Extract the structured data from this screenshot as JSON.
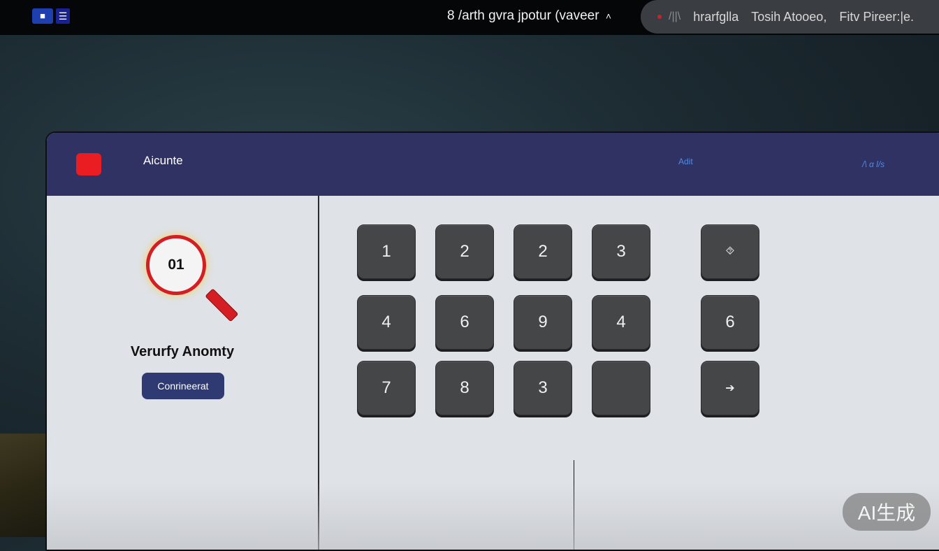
{
  "topbar": {
    "icon_a": "■",
    "icon_b": "☰",
    "title": "8 /arth gvra jpotur (vaveer",
    "title_caret": "˄",
    "pill": {
      "slash": "/||\\",
      "items": [
        "hrarfglla",
        "Tosih Atooeo,",
        "Fitv Pireer:|e."
      ]
    }
  },
  "window": {
    "app_name": "Aicunte",
    "header_link": "Adit",
    "header_icon_text": "/\\ α l/s",
    "verify": {
      "badge_number": "01",
      "title": "Verurfy Anomty",
      "confirm_label": "Conrineerat"
    },
    "keypad": [
      [
        "1",
        "2",
        "2",
        "3",
        "⯑"
      ],
      [
        "4",
        "6",
        "9",
        "4",
        "6"
      ],
      [
        "7",
        "8",
        "3",
        "",
        "➔"
      ]
    ]
  },
  "watermark": "AI生成",
  "colors": {
    "header_bg": "#2f3263",
    "logo_red": "#ea1d22",
    "button_bg": "#2f3a72",
    "key_bg": "#454648"
  }
}
